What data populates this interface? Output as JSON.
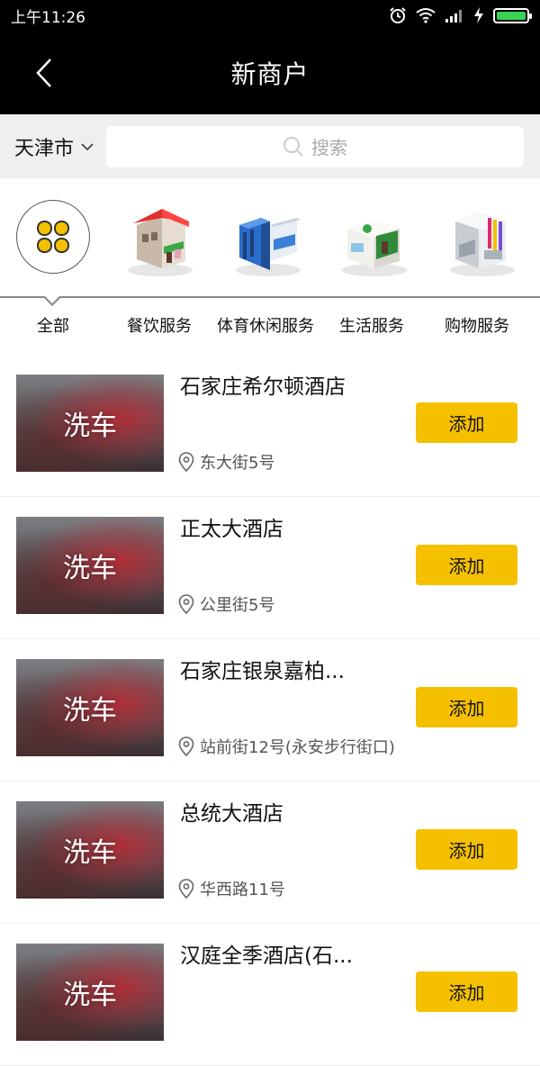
{
  "status_bar": {
    "time": "上午11:26"
  },
  "header": {
    "title": "新商户"
  },
  "search": {
    "city": "天津市",
    "placeholder": "搜索"
  },
  "categories": [
    {
      "label": "全部",
      "icon": "clover-icon"
    },
    {
      "label": "餐饮服务",
      "icon": "restaurant-building-icon"
    },
    {
      "label": "体育休闲服务",
      "icon": "sports-building-icon"
    },
    {
      "label": "生活服务",
      "icon": "life-service-building-icon"
    },
    {
      "label": "购物服务",
      "icon": "shopping-building-icon"
    }
  ],
  "merchants": [
    {
      "name": "石家庄希尔顿酒店",
      "address": "东大街5号",
      "thumb_text": "洗车",
      "button": "添加"
    },
    {
      "name": "正太大酒店",
      "address": "公里街5号",
      "thumb_text": "洗车",
      "button": "添加"
    },
    {
      "name": "石家庄银泉嘉柏...",
      "address": "站前街12号(永安步行街口)",
      "thumb_text": "洗车",
      "button": "添加"
    },
    {
      "name": "总统大酒店",
      "address": "华西路11号",
      "thumb_text": "洗车",
      "button": "添加"
    },
    {
      "name": "汉庭全季酒店(石...",
      "address": "",
      "thumb_text": "洗车",
      "button": "添加"
    }
  ],
  "colors": {
    "accent": "#f5c000",
    "header_bg": "#000000",
    "search_bg": "#efefef"
  }
}
